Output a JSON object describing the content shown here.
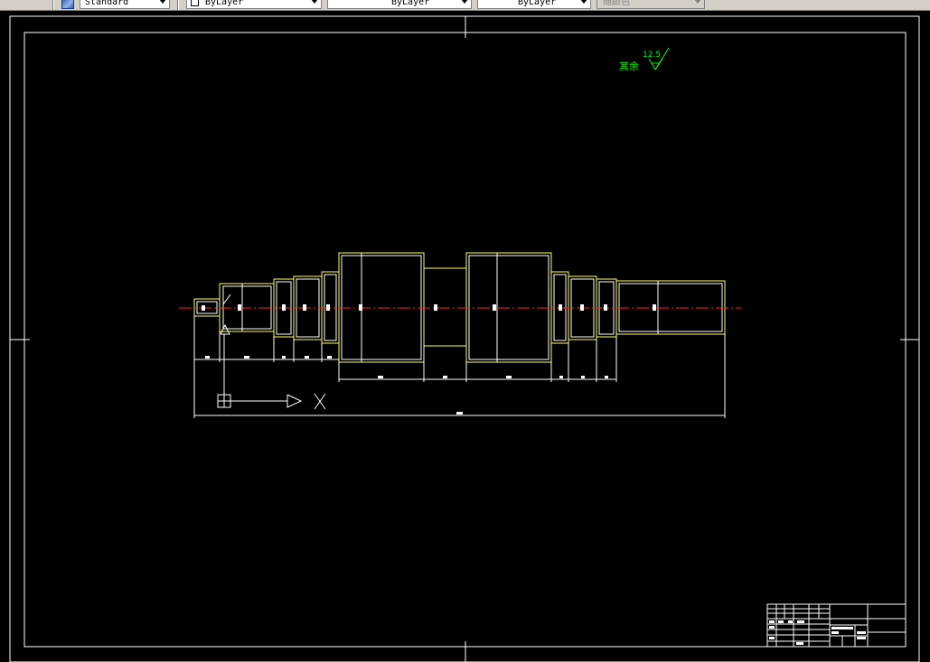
{
  "toolbar": {
    "text_style": "Standard",
    "layer_color": "ByLayer",
    "linetype": "ByLayer",
    "lineweight": "ByLayer",
    "plot_style": "随颜色"
  },
  "drawing": {
    "roughness_note": "其余",
    "roughness_value": "12.5"
  },
  "colors": {
    "background": "#000000",
    "frame": "#ffffff",
    "part_outline": "#ffff66",
    "centerline": "#ff2020",
    "annotation": "#00ff00"
  }
}
